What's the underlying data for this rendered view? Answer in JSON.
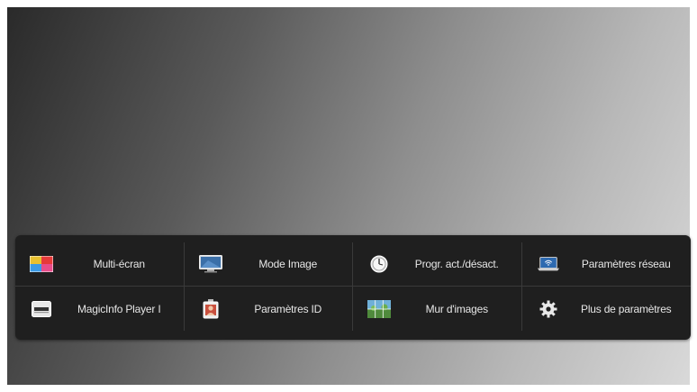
{
  "menu": {
    "items": [
      {
        "label": "Multi-écran",
        "icon": "multi-screen-icon"
      },
      {
        "label": "Mode Image",
        "icon": "monitor-icon"
      },
      {
        "label": "Progr. act./désact.",
        "icon": "timer-icon"
      },
      {
        "label": "Paramètres réseau",
        "icon": "network-laptop-icon"
      },
      {
        "label": "MagicInfo Player I",
        "icon": "player-icon"
      },
      {
        "label": "Paramètres ID",
        "icon": "id-badge-icon"
      },
      {
        "label": "Mur d'images",
        "icon": "video-wall-icon"
      },
      {
        "label": "Plus de paramètres",
        "icon": "gear-icon"
      }
    ]
  },
  "colors": {
    "panel_bg": "#1f1f1f",
    "text": "#e6e6e6",
    "divider": "#3a3a3a"
  }
}
